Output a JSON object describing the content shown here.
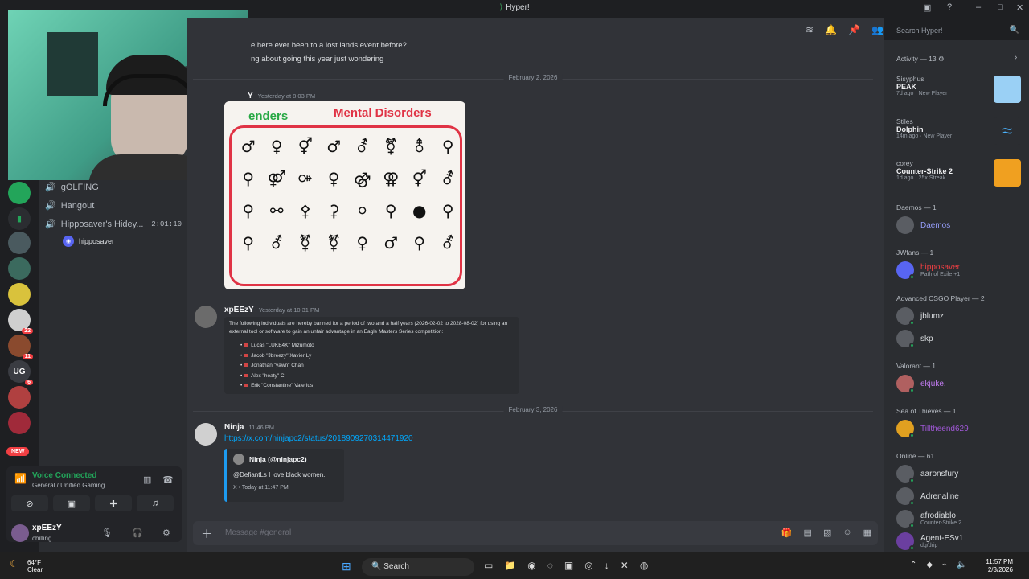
{
  "window": {
    "title": "Hyper!",
    "minimize": "–",
    "maximize": "□",
    "close": "✕"
  },
  "servers": [
    {
      "label": "",
      "badge": ""
    },
    {
      "label": "",
      "badge": ""
    },
    {
      "label": "",
      "badge": ""
    },
    {
      "label": "",
      "badge": ""
    },
    {
      "label": "",
      "badge": "22"
    },
    {
      "label": "",
      "badge": "11"
    },
    {
      "label": "UG",
      "badge": "6"
    },
    {
      "label": "",
      "badge": ""
    },
    {
      "label": "",
      "badge": ""
    }
  ],
  "new_pill": "NEW",
  "channels": {
    "items": [
      {
        "label": "gOLFING",
        "time": ""
      },
      {
        "label": "Hangout",
        "time": ""
      },
      {
        "label": "Hipposaver's Hidey...",
        "time": "2:01:10"
      }
    ],
    "voice_user": "hipposaver"
  },
  "voice_panel": {
    "title": "Voice Connected",
    "subtitle": "General / Unified Gaming"
  },
  "user_panel": {
    "name": "xpEEzY",
    "status": "chilling"
  },
  "topbar": {
    "search_placeholder": "Search Hyper!"
  },
  "messages": {
    "top_line_1": "e here ever been to a lost lands event before?",
    "top_line_2": "ng about going this year just wondering",
    "date_1": "February 2, 2026",
    "author_1": "xpEEzY",
    "author_1_short": "Y",
    "ts_1": "Yesterday at 8:03 PM",
    "image": {
      "title_left": "enders",
      "title_right": "Mental Disorders",
      "symbols": [
        "♂",
        "♀",
        "⚥",
        "♂",
        "⚦",
        "⚧",
        "⚨",
        "⚲",
        "⚲",
        "⚤",
        "⚩",
        "♀",
        "⚣",
        "⚢",
        "⚥",
        "⚦",
        "⚲",
        "⚯",
        "⚴",
        "⚳",
        "⚪",
        "⚲",
        "●",
        "⚲",
        "⚲",
        "⚦",
        "⚧",
        "⚧",
        "♀",
        "♂",
        "⚲",
        "⚦"
      ]
    },
    "author_2": "xpEEzY",
    "ts_2": "Yesterday at 10:31 PM",
    "ban": {
      "intro": "The following individuals are hereby banned for a period of two and a half years (2026-02-02 to 2028-08-02) for using an external tool or software to gain an unfair advantage in an Eagle Masters Series competition:",
      "list": [
        "Lucas \"LUKE4K\" Mizumoto",
        "Jacob \"Jbreezy\" Xavier Ly",
        "Jonathan \"yawn\" Chan",
        "Alex \"heaty\" C.",
        "Erik \"Constantine\" Valerius"
      ]
    },
    "date_2": "February 3, 2026",
    "author_3": "Ninja",
    "ts_3": "11:46 PM",
    "link": "https://x.com/ninjapc2/status/2018909270314471920",
    "tweet": {
      "author": "Ninja (@ninjapc2)",
      "body": "@DefiantLs I love black women.",
      "footer": "X • Today at 11:47 PM"
    }
  },
  "composer": {
    "placeholder": "Message #general"
  },
  "members": {
    "activity_title": "Activity — 13",
    "activities": [
      {
        "name": "Sisyphus",
        "game": "PEAK",
        "meta": "7d ago · New Player"
      },
      {
        "name": "Stiles",
        "game": "Dolphin",
        "meta": "14m ago · New Player"
      },
      {
        "name": "corey",
        "game": "Counter-Strike 2",
        "meta": "1d ago · 25x Streak"
      }
    ],
    "groups": [
      {
        "title": "Daemos — 1",
        "members": [
          {
            "name": "Daemos",
            "sub": "",
            "color": "#949cf7"
          }
        ]
      },
      {
        "title": "JWfans — 1",
        "members": [
          {
            "name": "hipposaver",
            "sub": "Path of Exile +1",
            "color": "#f23f43"
          }
        ]
      },
      {
        "title": "Advanced CSGO Player — 2",
        "members": [
          {
            "name": "jblumz",
            "sub": "",
            "color": "#dbdee1"
          },
          {
            "name": "skp",
            "sub": "",
            "color": "#dbdee1"
          }
        ]
      },
      {
        "title": "Valorant — 1",
        "members": [
          {
            "name": "ekjuke.",
            "sub": "",
            "color": "#c27cf2"
          }
        ]
      },
      {
        "title": "Sea of Thieves — 1",
        "members": [
          {
            "name": "Tilltheend629",
            "sub": "",
            "color": "#a158d8"
          }
        ]
      },
      {
        "title": "Online — 61",
        "members": [
          {
            "name": "aaronsfury",
            "sub": "",
            "color": "#dbdee1"
          },
          {
            "name": "Adrenaline",
            "sub": "",
            "color": "#dbdee1"
          },
          {
            "name": "afrodiablo",
            "sub": "Counter-Strike 2",
            "color": "#dbdee1"
          },
          {
            "name": "Agent-ESv1",
            "sub": "dg/drip",
            "color": "#dbdee1"
          }
        ]
      }
    ]
  },
  "taskbar": {
    "temp": "64°F",
    "cond": "Clear",
    "search": "Search",
    "time": "11:57 PM",
    "date": "2/3/2026"
  },
  "colors": {
    "accent": "#5865f2",
    "online": "#23a55a",
    "link": "#00a8fc"
  }
}
